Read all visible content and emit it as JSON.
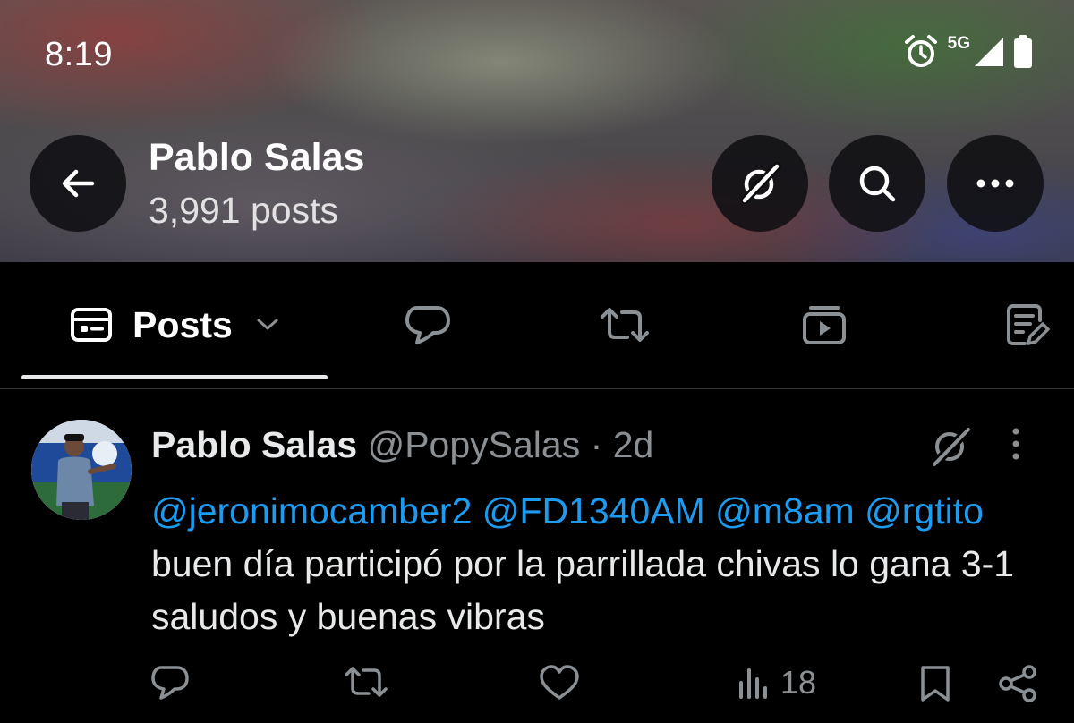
{
  "status_bar": {
    "time": "8:19",
    "network": "5G",
    "icons": [
      "alarm-icon",
      "signal-icon",
      "battery-icon"
    ]
  },
  "header": {
    "profile_name": "Pablo Salas",
    "post_count": "3,991 posts",
    "buttons": [
      "back-arrow-icon",
      "grok-icon",
      "search-icon",
      "more-horizontal-icon"
    ]
  },
  "tabs": {
    "active_label": "Posts",
    "items": [
      "posts-icon",
      "replies-icon",
      "reposts-icon",
      "media-icon",
      "articles-icon"
    ]
  },
  "post": {
    "author_name": "Pablo Salas",
    "handle": "@PopySalas",
    "separator": "·",
    "time_ago": "2d",
    "mentions": [
      "@jeronimocamber2",
      "@FD1340AM",
      "@m8am",
      "@rgtito"
    ],
    "text": "buen día participó por la parrillada chivas lo gana 3-1 saludos y buenas vibras",
    "views": "18"
  },
  "colors": {
    "accent": "#1d9bf0",
    "background": "#000000",
    "text_primary": "#e7e9ea",
    "text_secondary": "#8b9095"
  }
}
